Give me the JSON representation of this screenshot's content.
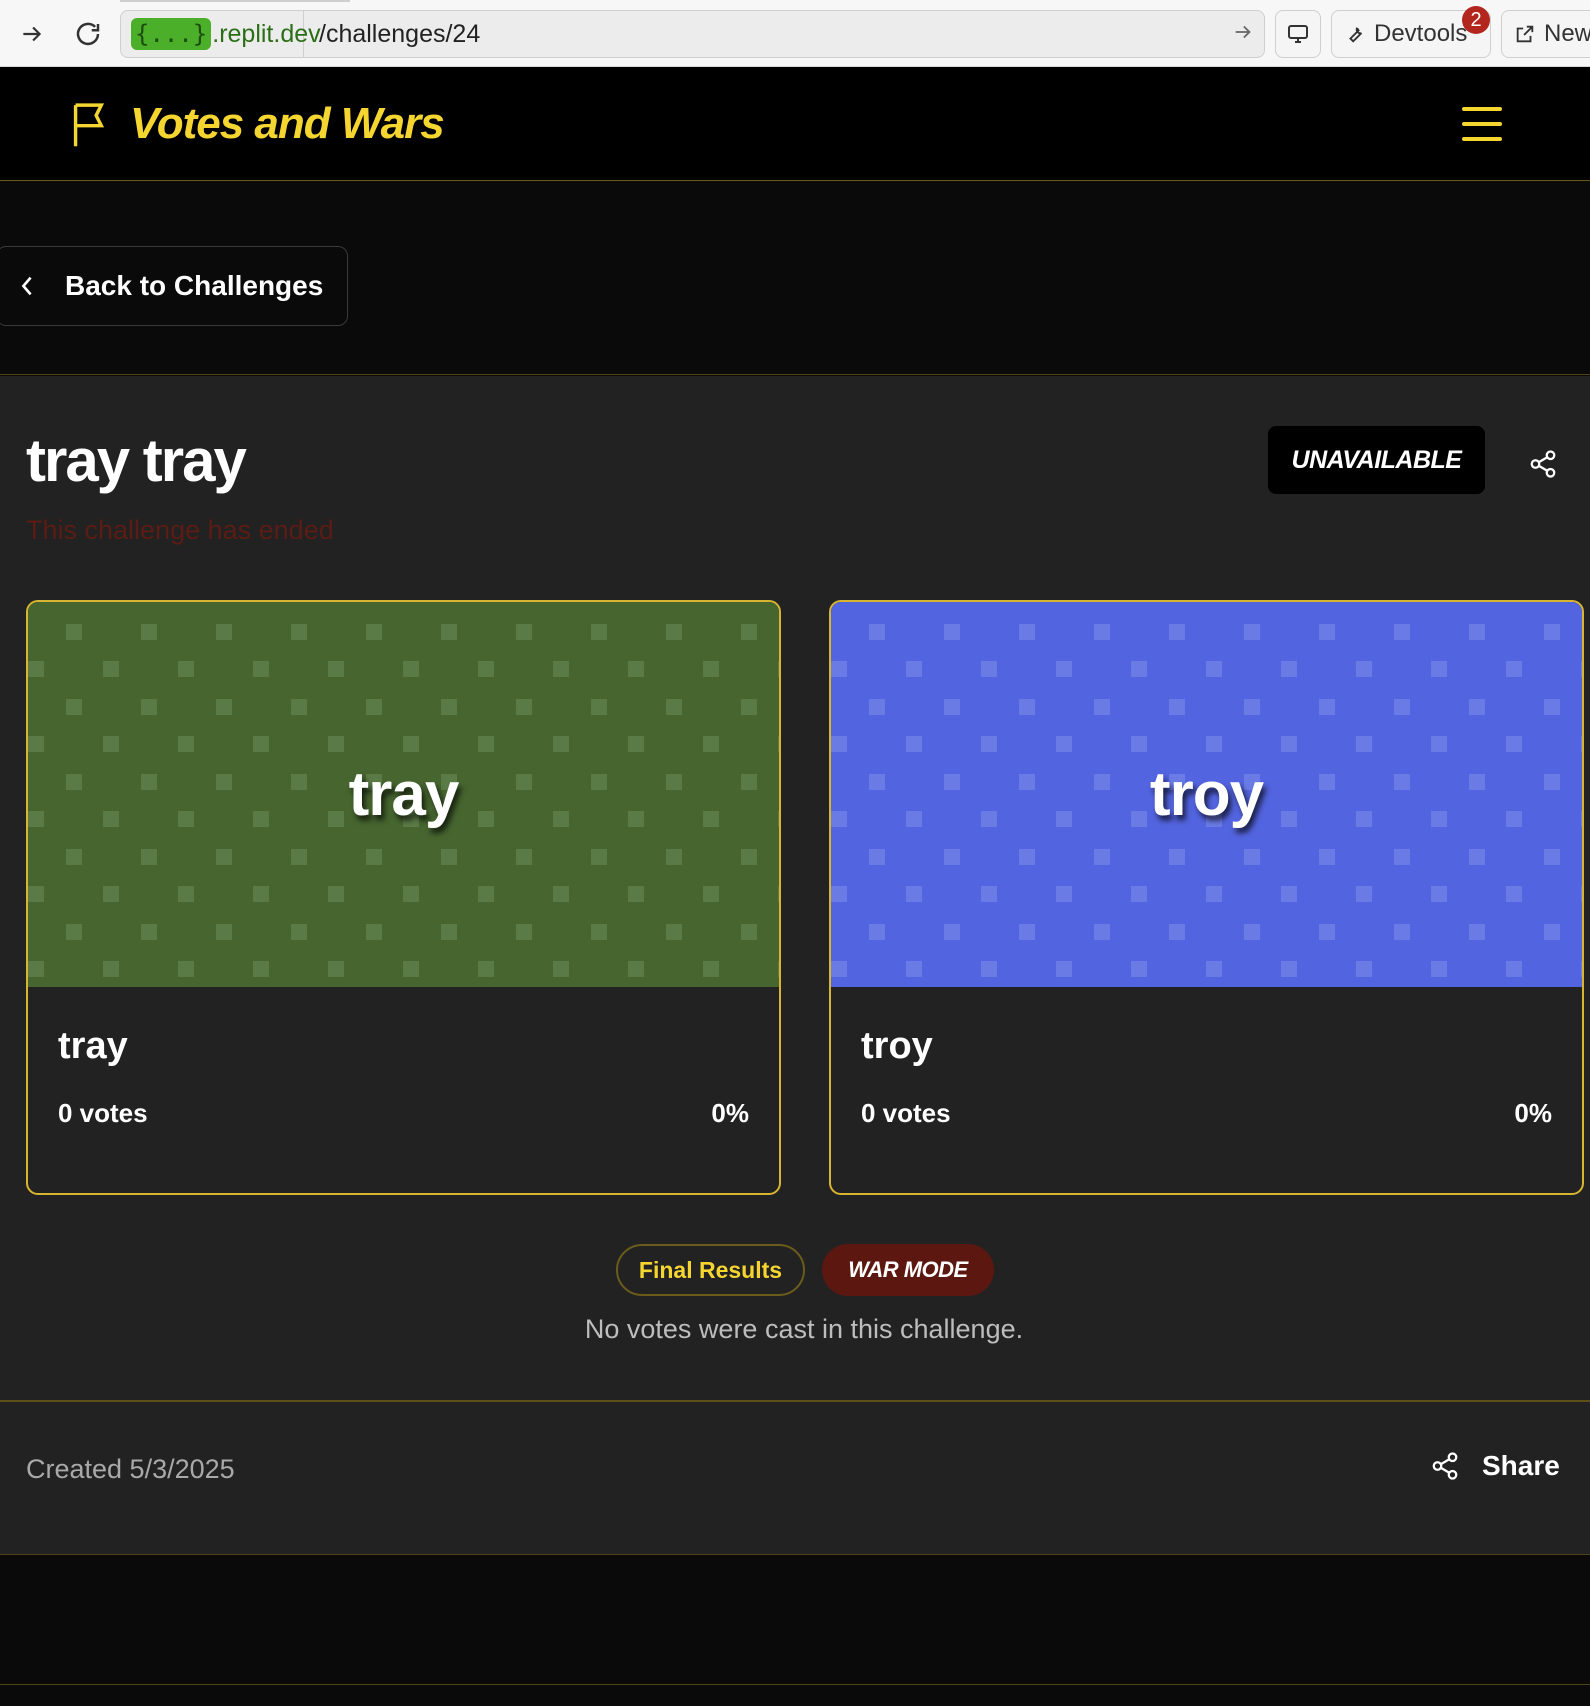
{
  "browser": {
    "url_badge": "{...}",
    "url_host": ".replit.dev",
    "url_path": "/challenges/24",
    "devtools_label": "Devtools",
    "devtools_badge": "2",
    "new_tab_label": "New"
  },
  "header": {
    "brand": "Votes and Wars",
    "accent_color": "#f5d530"
  },
  "back": {
    "label": "Back to Challenges"
  },
  "challenge": {
    "title": "tray tray",
    "status_text": "This challenge has ended",
    "availability_badge": "UNAVAILABLE",
    "options": [
      {
        "image_word": "tray",
        "name": "tray",
        "votes": "0 votes",
        "percent": "0%",
        "bg_color": "#46652f"
      },
      {
        "image_word": "troy",
        "name": "troy",
        "votes": "0 votes",
        "percent": "0%",
        "bg_color": "#5364e0"
      }
    ],
    "final_results_label": "Final Results",
    "war_mode_label": "WAR MODE",
    "no_votes_text": "No votes were cast in this challenge."
  },
  "footer": {
    "created_text": "Created 5/3/2025",
    "share_label": "Share"
  }
}
